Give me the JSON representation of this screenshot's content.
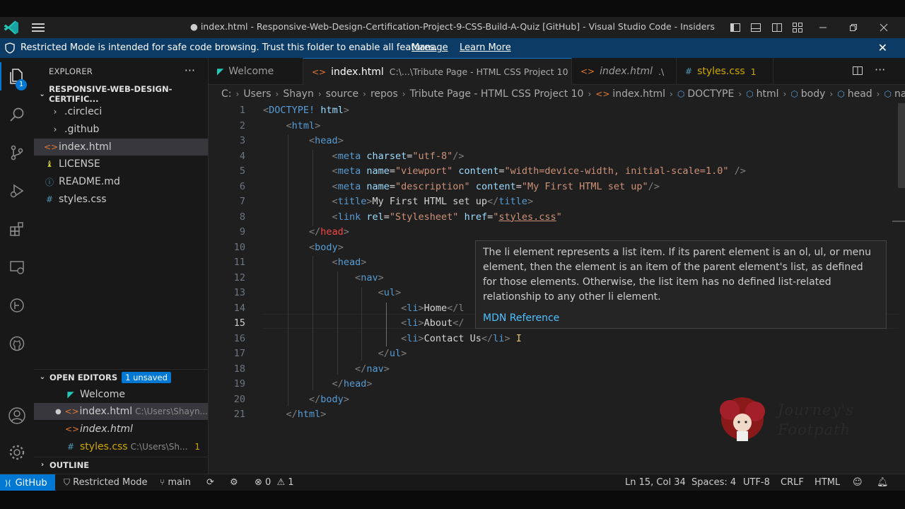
{
  "window": {
    "title": "● index.html - Responsive-Web-Design-Certification-Project-9-CSS-Build-A-Quiz [GitHub] - Visual Studio Code - Insiders"
  },
  "banner": {
    "message": "Restricted Mode is intended for safe code browsing. Trust this folder to enable all features.",
    "manage": "Manage",
    "learn_more": "Learn More"
  },
  "activity": {
    "explorer_badge": "1"
  },
  "sidebar": {
    "title": "EXPLORER",
    "more": "···",
    "folder": "RESPONSIVE-WEB-DESIGN-CERTIFIC...",
    "items": [
      {
        "label": ".circleci",
        "icon": "chevron-right-icon"
      },
      {
        "label": ".github",
        "icon": "chevron-right-icon"
      },
      {
        "label": "index.html",
        "icon": "html-file-icon"
      },
      {
        "label": "LICENSE",
        "icon": "license-icon"
      },
      {
        "label": "README.md",
        "icon": "info-icon"
      },
      {
        "label": "styles.css",
        "icon": "css-hash-icon"
      }
    ],
    "open_editors": {
      "title": "OPEN EDITORS",
      "badge": "1 unsaved",
      "items": [
        {
          "label": "Welcome",
          "path": ""
        },
        {
          "label": "index.html",
          "path": "C:\\Users\\Shayn..."
        },
        {
          "label": "index.html",
          "path": ""
        },
        {
          "label": "styles.css",
          "path": "C:\\Users\\Sh...",
          "count": "1"
        }
      ]
    },
    "outline": "OUTLINE"
  },
  "tabs": [
    {
      "label": "Welcome",
      "path": ""
    },
    {
      "label": "index.html",
      "path": "C:\\...\\Tribute Page - HTML CSS Project 10"
    },
    {
      "label": "index.html",
      "path": ".\\"
    },
    {
      "label": "styles.css",
      "path": "1"
    }
  ],
  "breadcrumb": [
    "C:",
    "Users",
    "Shayn",
    "source",
    "repos",
    "Tribute Page - HTML CSS Project 10",
    "index.html",
    "DOCTYPE",
    "html",
    "body",
    "head",
    "na"
  ],
  "editor": {
    "line_numbers": [
      "1",
      "2",
      "3",
      "4",
      "5",
      "6",
      "7",
      "8",
      "9",
      "10",
      "11",
      "12",
      "13",
      "14",
      "15",
      "16",
      "17",
      "18",
      "19",
      "20",
      "21"
    ],
    "current_line": "15",
    "hover": {
      "text": "The li element represents a list item. If its parent element is an ol, ul, or menu element, then the element is an item of the parent element's list, as defined for those elements. Otherwise, the list item has no defined list-related relationship to any other li element.",
      "link": "MDN Reference"
    }
  },
  "watermark": {
    "line1": "Journey's",
    "line2": "Footpath"
  },
  "status": {
    "remote": "GitHub",
    "restricted": "Restricted Mode",
    "branch": "main",
    "errors": "0",
    "warnings": "1",
    "position": "Ln 15, Col 34",
    "spaces": "Spaces: 4",
    "encoding": "UTF-8",
    "eol": "CRLF",
    "language": "HTML"
  },
  "colors": {
    "accent": "#0078d4",
    "banner": "#0c3b66",
    "tag": "#569cd6",
    "attr": "#9cdcfe",
    "string": "#ce9178",
    "error_tag": "#f44747"
  }
}
